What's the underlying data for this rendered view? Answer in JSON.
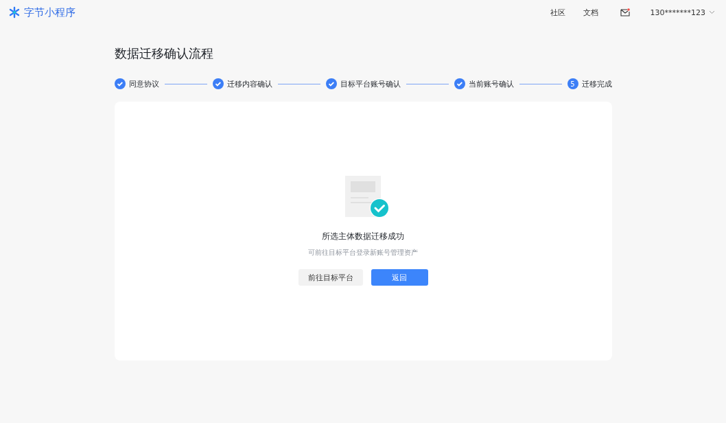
{
  "header": {
    "logo": "字节小程序",
    "nav": [
      {
        "label": "社区"
      },
      {
        "label": "文档"
      }
    ],
    "account": "130*******123",
    "mail_unread": true
  },
  "page_title": "数据迁移确认流程",
  "steps": [
    {
      "label": "同意协议",
      "kind": "done"
    },
    {
      "label": "迁移内容确认",
      "kind": "done"
    },
    {
      "label": "目标平台账号确认",
      "kind": "done"
    },
    {
      "label": "当前账号确认",
      "kind": "done"
    },
    {
      "label": "迁移完成",
      "kind": "current",
      "number": "5"
    }
  ],
  "result": {
    "title": "所选主体数据迁移成功",
    "subtitle": "可前往目标平台登录新账号管理资产",
    "buttons": [
      {
        "label": "前往目标平台",
        "kind": "secondary"
      },
      {
        "label": "返回",
        "kind": "primary"
      }
    ]
  }
}
